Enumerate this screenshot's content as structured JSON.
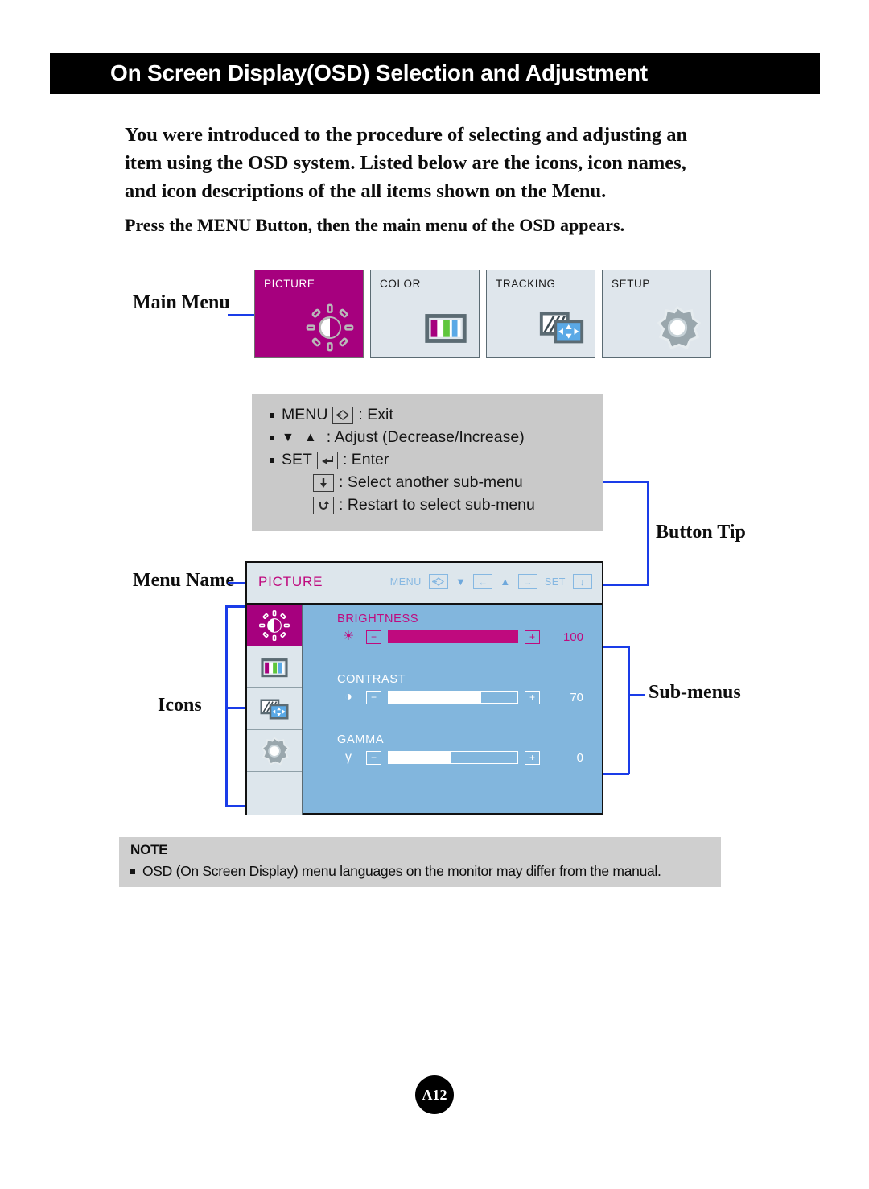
{
  "header": {
    "title": "On Screen Display(OSD) Selection and Adjustment"
  },
  "intro": {
    "paragraph": "You were introduced to the procedure of selecting and adjusting an item using the OSD system.  Listed below are the icons, icon names, and icon descriptions of the all items shown on the Menu.",
    "press_line": "Press the MENU Button, then the main menu of the OSD appears."
  },
  "annotations": {
    "main_menu": "Main Menu",
    "menu_name": "Menu Name",
    "icons": "Icons",
    "button_tip": "Button Tip",
    "sub_menus": "Sub-menus"
  },
  "main_menu_tiles": [
    {
      "label": "PICTURE",
      "icon": "brightness-sun-icon",
      "active": true
    },
    {
      "label": "COLOR",
      "icon": "color-bars-icon",
      "active": false
    },
    {
      "label": "TRACKING",
      "icon": "tracking-screen-icon",
      "active": false
    },
    {
      "label": "SETUP",
      "icon": "gear-icon",
      "active": false
    }
  ],
  "button_tip": {
    "lines": [
      {
        "bullet": true,
        "label": "MENU",
        "key": "exit-diamond-icon",
        "key_glyph": "⇆",
        "desc": ": Exit"
      },
      {
        "bullet": true,
        "label": "",
        "key": "down-up-triangles",
        "key_glyph": "",
        "desc": ": Adjust (Decrease/Increase)"
      },
      {
        "bullet": true,
        "label": "SET",
        "key": "enter-icon",
        "key_glyph": "↵",
        "desc": ": Enter"
      },
      {
        "bullet": false,
        "label": "",
        "key": "down-arrow-icon",
        "key_glyph": "↓",
        "desc": ": Select another sub-menu"
      },
      {
        "bullet": false,
        "label": "",
        "key": "restart-icon",
        "key_glyph": "↶",
        "desc": ": Restart to select sub-menu"
      }
    ]
  },
  "osd": {
    "title": "PICTURE",
    "keys": [
      {
        "label": "MENU",
        "glyph": "⇆",
        "icon": "exit-diamond-icon"
      },
      {
        "label": "",
        "glyph": "←",
        "icon": "decrease-left-icon",
        "tri": "▼"
      },
      {
        "label": "",
        "glyph": "→",
        "icon": "increase-right-icon",
        "tri": "▲"
      },
      {
        "label": "SET",
        "glyph": "↓",
        "icon": "select-down-icon"
      }
    ],
    "side_icons": [
      {
        "icon": "brightness-sun-icon",
        "active": true
      },
      {
        "icon": "color-bars-icon",
        "active": false
      },
      {
        "icon": "tracking-screen-icon",
        "active": false
      },
      {
        "icon": "gear-icon",
        "active": false
      },
      {
        "icon": "empty-cell",
        "active": false
      }
    ],
    "submenus": [
      {
        "name": "BRIGHTNESS",
        "icon": "sun-icon",
        "glyph": "☀",
        "value": "100",
        "percent": 100,
        "highlighted": true
      },
      {
        "name": "CONTRAST",
        "icon": "contrast-icon",
        "glyph": "◑",
        "value": "70",
        "percent": 72,
        "highlighted": false
      },
      {
        "name": "GAMMA",
        "icon": "gamma-icon",
        "glyph": "γ",
        "value": "0",
        "percent": 48,
        "highlighted": false
      }
    ],
    "minus_glyph": "−",
    "plus_glyph": "+"
  },
  "note": {
    "title": "NOTE",
    "text": "OSD (On Screen Display) menu languages on the monitor may differ from the manual."
  },
  "page_number": "A12",
  "colors": {
    "magenta": "#a6007e",
    "osd_body_blue": "#82b6dd",
    "osd_panel_gray": "#dde6ec",
    "connector_blue": "#1a3ce8",
    "tip_gray": "#c9c9c9",
    "note_gray": "#cfcfcf"
  }
}
